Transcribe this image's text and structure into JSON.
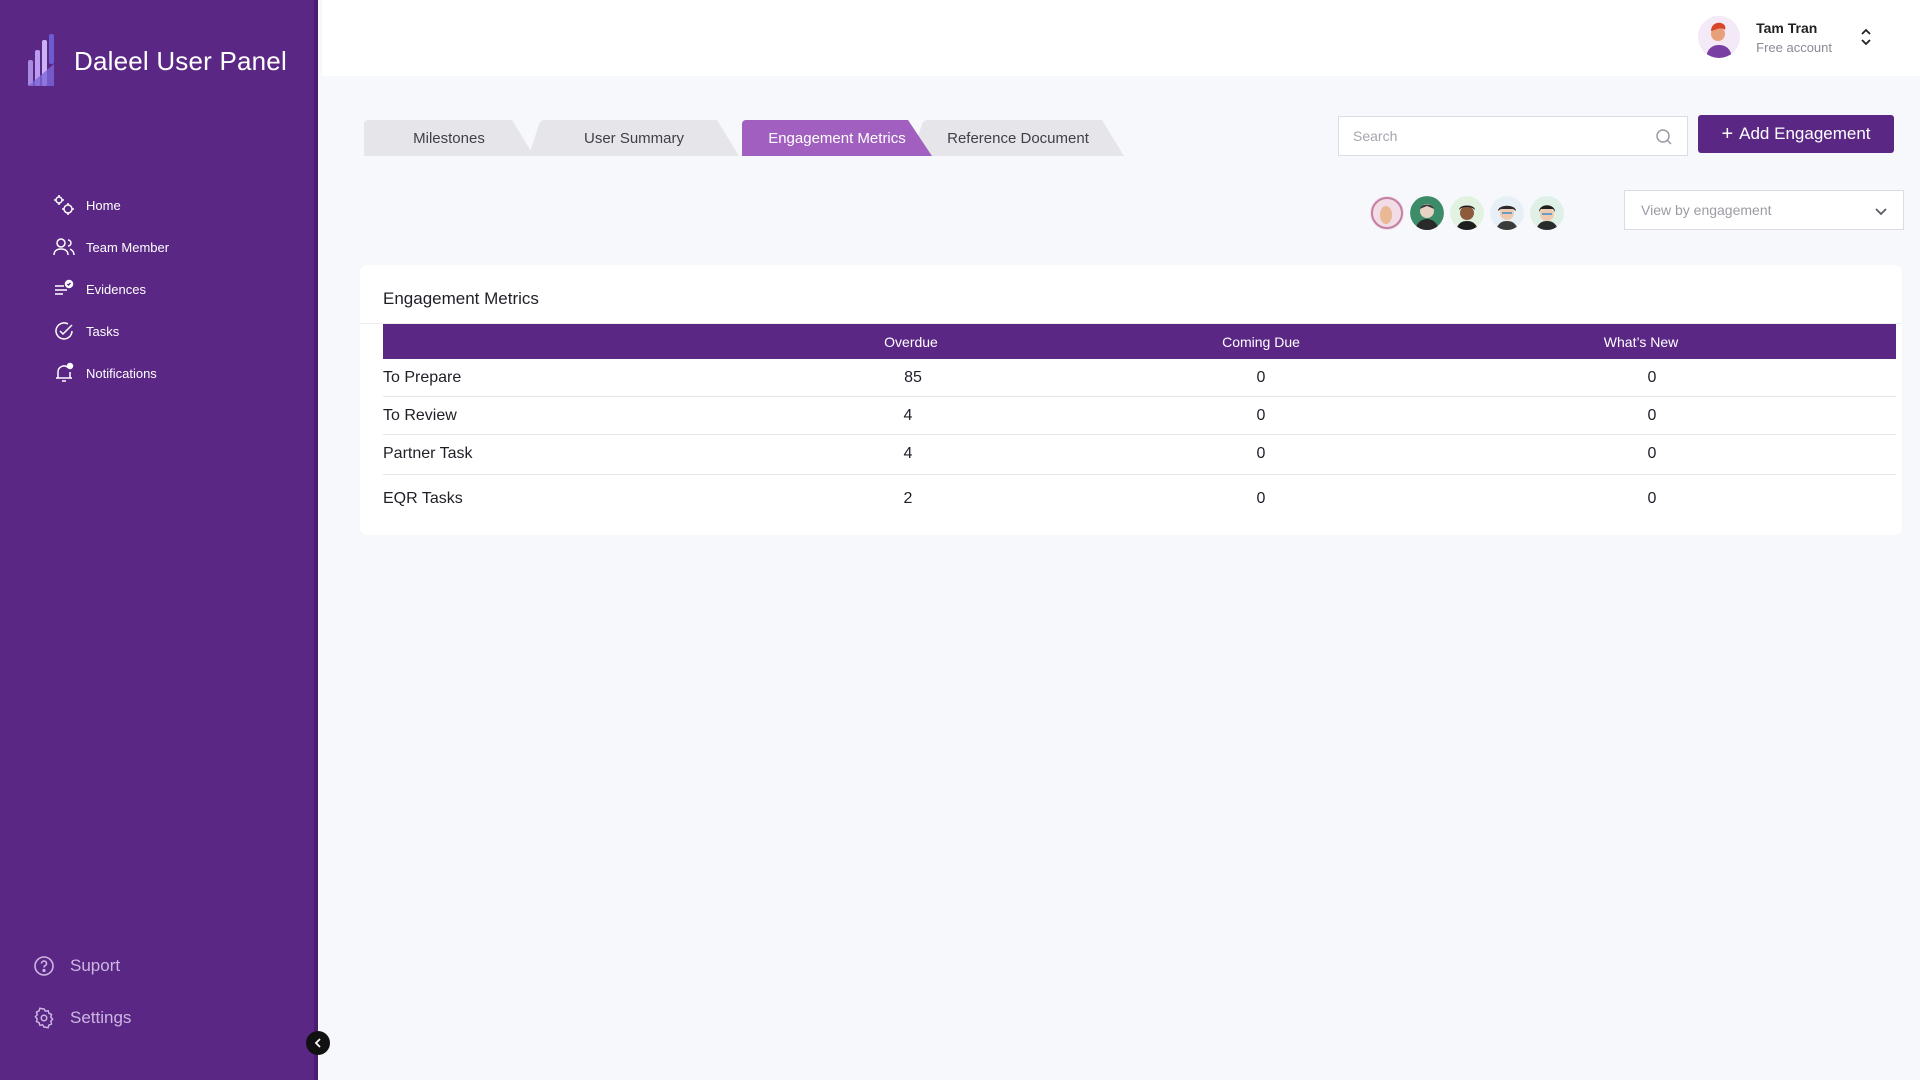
{
  "app": {
    "title": "Daleel User Panel"
  },
  "sidebar": {
    "items": [
      {
        "label": "Home",
        "icon": "home-gears-icon"
      },
      {
        "label": "Team Member",
        "icon": "team-icon"
      },
      {
        "label": "Evidences",
        "icon": "evidences-icon"
      },
      {
        "label": "Tasks",
        "icon": "tasks-icon"
      },
      {
        "label": "Notifications",
        "icon": "bell-icon"
      }
    ],
    "bottom": [
      {
        "label": "Suport",
        "icon": "help-icon"
      },
      {
        "label": "Settings",
        "icon": "gear-icon"
      }
    ]
  },
  "user": {
    "name": "Tam Tran",
    "plan": "Free account"
  },
  "tabs": [
    {
      "label": "Milestones",
      "active": false
    },
    {
      "label": "User Summary",
      "active": false
    },
    {
      "label": "Engagement Metrics",
      "active": true
    },
    {
      "label": "Reference Document",
      "active": false
    }
  ],
  "search": {
    "placeholder": "Search"
  },
  "actions": {
    "add_label": "Add Engagement"
  },
  "filter": {
    "selected": "View by engagement"
  },
  "metrics": {
    "title": "Engagement Metrics",
    "columns": [
      "Overdue",
      "Coming Due",
      "What’s New"
    ],
    "rows": [
      {
        "label": "To Prepare",
        "overdue": "85",
        "coming_due": "0",
        "whats_new": "0"
      },
      {
        "label": "To Review",
        "overdue": "4",
        "coming_due": "0",
        "whats_new": "0"
      },
      {
        "label": "Partner Task",
        "overdue": "4",
        "coming_due": "0",
        "whats_new": "0"
      },
      {
        "label": "EQR Tasks",
        "overdue": "2",
        "coming_due": "0",
        "whats_new": "0"
      }
    ]
  },
  "colors": {
    "brand": "#5b2785",
    "active_tab": "#a160c0",
    "tab_inactive": "#e6e6ea"
  }
}
